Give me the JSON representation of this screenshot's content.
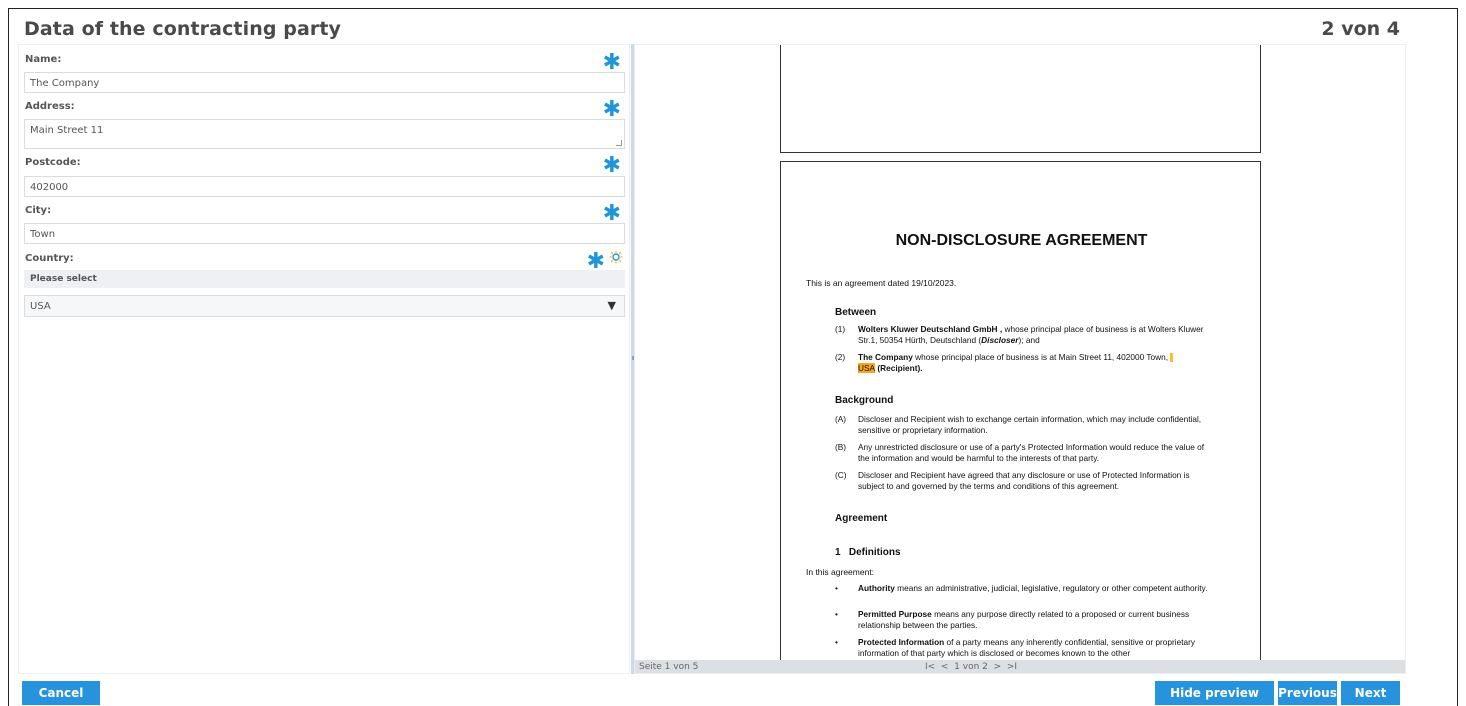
{
  "header": {
    "title": "Data of the contracting party",
    "page_count": "2 von 4"
  },
  "form": {
    "name_label": "Name:",
    "name_value": "The Company",
    "address_label": "Address:",
    "address_value": "Main Street 11",
    "postcode_label": "Postcode:",
    "postcode_value": "402000",
    "city_label": "City:",
    "city_value": "Town",
    "country_label": "Country:",
    "country_select_header": "Please select",
    "country_value": "USA",
    "required_symbol": "✱",
    "accent_color": "#2196d6"
  },
  "preview": {
    "doc_title": "NON-DISCLOSURE AGREEMENT",
    "intro": "This is an agreement dated 19/10/2023.",
    "between_heading": "Between",
    "party1_num": "(1)",
    "party1_name": "Wolters Kluwer Deutschland GmbH ,",
    "party1_text": " whose principal place of business is at Wolters Kluwer Str.1, 50354 Hürth, Deutschland (",
    "party1_role": "Discloser",
    "party1_end": "); and",
    "party2_num": "(2)",
    "party2_name": "The Company",
    "party2_text": " whose principal place of business is at Main Street 11, 402000 Town, ",
    "party2_country": "USA",
    "party2_role": " (Recipient).",
    "background_heading": "Background",
    "bg_a_num": "(A)",
    "bg_a": "Discloser and Recipient wish to exchange certain information, which may include confidential, sensitive or proprietary information.",
    "bg_b_num": "(B)",
    "bg_b": "Any unrestricted disclosure or use of a party's Protected Information would reduce the value of the information and would be harmful to the interests of that party.",
    "bg_c_num": "(C)",
    "bg_c": "Discloser and Recipient have agreed that any disclosure or use of Protected Information is subject to and governed by the terms and conditions of this agreement.",
    "agreement_heading": "Agreement",
    "definitions_heading": "1   Definitions",
    "in_this_agreement": "In this agreement:",
    "bullet": "•",
    "def1_term": "Authority",
    "def1_text": " means an administrative, judicial, legislative, regulatory or other competent authority.",
    "def2_term": "Permitted Purpose",
    "def2_text": " means any purpose directly related to a proposed or current business relationship between the parties.",
    "def3_term": "Protected Information",
    "def3_text": " of a party means any inherently confidential, sensitive or proprietary information of that party which is disclosed or becomes known to the other",
    "status_page": "Seite 1 von 5",
    "status_nav": "I<  <  1 von 2  >  >I"
  },
  "footer": {
    "cancel": "Cancel",
    "hide_preview": "Hide preview",
    "previous": "Previous",
    "next": "Next",
    "button_color": "#2793dc"
  }
}
